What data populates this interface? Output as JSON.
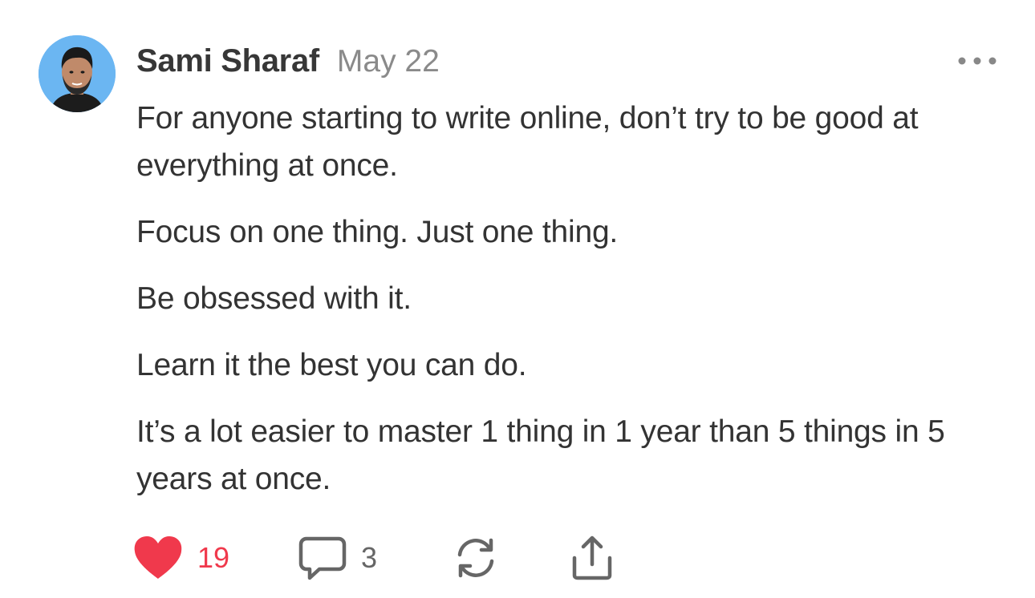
{
  "post": {
    "author": "Sami Sharaf",
    "date": "May 22",
    "paragraphs": [
      "For anyone starting to write online, don’t try to be good at everything at once.",
      "Focus on one thing. Just one thing.",
      "Be obsessed with it.",
      "Learn it the best you can do.",
      "It’s a lot easier to master 1 thing in 1 year than 5 things in 5 years at once."
    ]
  },
  "actions": {
    "likes": "19",
    "comments": "3"
  },
  "icons": {
    "more": "more-horizontal-icon",
    "like": "heart-icon",
    "comment": "comment-bubble-icon",
    "restack": "restack-icon",
    "share": "share-icon"
  },
  "colors": {
    "like": "#f0394c",
    "text": "#333333",
    "muted": "#8a8a8a",
    "avatar_bg": "#6bb6f2"
  }
}
